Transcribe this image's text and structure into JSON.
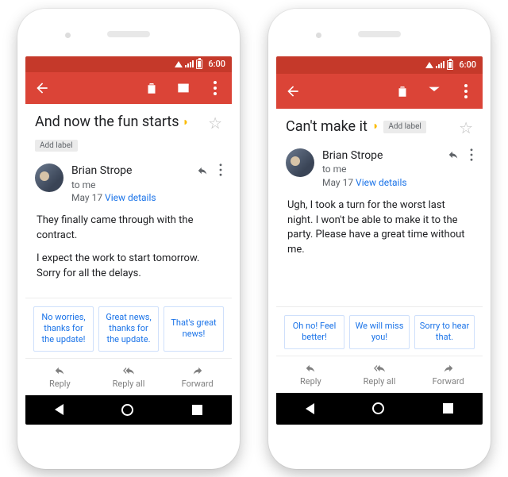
{
  "status": {
    "time": "6:00"
  },
  "phones": [
    {
      "subject": "And now the fun starts",
      "label_chip": "Add label",
      "sender": {
        "name": "Brian Strope",
        "to": "to me",
        "date": "May 17",
        "view_details": "View details"
      },
      "body_paragraphs": [
        "They finally came through with the contract.",
        "I expect the work to start tomorrow. Sorry for all the delays."
      ],
      "smart_replies": [
        "No worries, thanks for the update!",
        "Great news, thanks for the update.",
        "That's great news!"
      ]
    },
    {
      "subject": "Can't make it",
      "label_chip": "Add label",
      "sender": {
        "name": "Brian Strope",
        "to": "to me",
        "date": "May 17",
        "view_details": "View details"
      },
      "body_paragraphs": [
        "Ugh, I took a turn for the worst last night. I won't be able to make it to the party. Please have a great time without me."
      ],
      "smart_replies": [
        "Oh no! Feel better!",
        "We will miss you!",
        "Sorry to hear that."
      ]
    }
  ],
  "bottom": {
    "reply": "Reply",
    "reply_all": "Reply all",
    "forward": "Forward"
  }
}
